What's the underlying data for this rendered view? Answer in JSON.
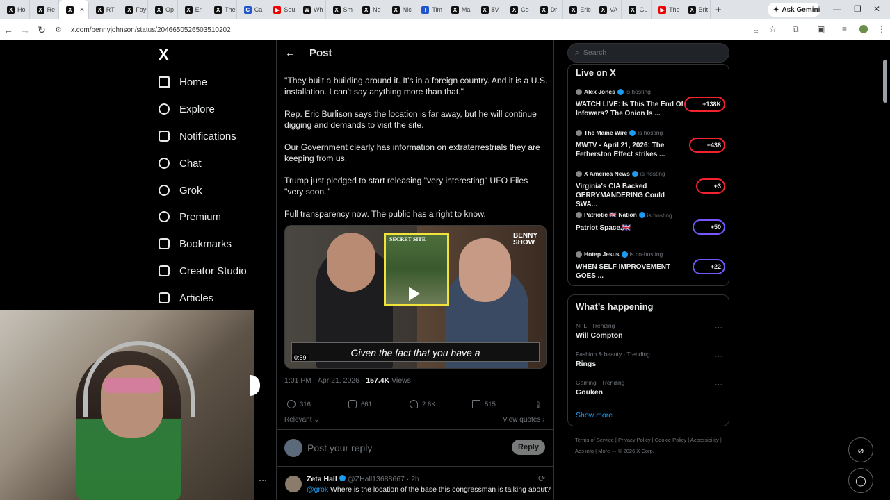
{
  "browser": {
    "tabs": [
      {
        "label": "Ho",
        "fav": "X"
      },
      {
        "label": "Re",
        "fav": "X"
      },
      {
        "label": "",
        "fav": "X",
        "active": true
      },
      {
        "label": "RT",
        "fav": "X"
      },
      {
        "label": "Fay",
        "fav": "X"
      },
      {
        "label": "Op",
        "fav": "X"
      },
      {
        "label": "Eri",
        "fav": "X"
      },
      {
        "label": "The",
        "fav": "X"
      },
      {
        "label": "Ca",
        "fav": "C"
      },
      {
        "label": "Sou",
        "fav": "▶"
      },
      {
        "label": "Wh",
        "fav": "W"
      },
      {
        "label": "Sm",
        "fav": "X"
      },
      {
        "label": "Ne",
        "fav": "X"
      },
      {
        "label": "Nic",
        "fav": "X"
      },
      {
        "label": "Tim",
        "fav": "T"
      },
      {
        "label": "Ma",
        "fav": "X"
      },
      {
        "label": "$V",
        "fav": "X"
      },
      {
        "label": "Co",
        "fav": "X"
      },
      {
        "label": "Dr",
        "fav": "X"
      },
      {
        "label": "Eric",
        "fav": "X"
      },
      {
        "label": "VA",
        "fav": "X"
      },
      {
        "label": "Gu",
        "fav": "X"
      },
      {
        "label": "The",
        "fav": "▶"
      },
      {
        "label": "Brit",
        "fav": "X"
      }
    ],
    "new_tab": "+",
    "ask_gemini": "Ask Gemini",
    "url": "x.com/bennyjohnson/status/2046650526503510202"
  },
  "nav": {
    "logo": "X",
    "items": [
      {
        "label": "Home",
        "name": "home"
      },
      {
        "label": "Explore",
        "name": "explore"
      },
      {
        "label": "Notifications",
        "name": "notifications"
      },
      {
        "label": "Chat",
        "name": "chat"
      },
      {
        "label": "Grok",
        "name": "grok"
      },
      {
        "label": "Premium",
        "name": "premium"
      },
      {
        "label": "Bookmarks",
        "name": "bookmarks"
      },
      {
        "label": "Creator Studio",
        "name": "creator-studio"
      },
      {
        "label": "Articles",
        "name": "articles"
      }
    ]
  },
  "post": {
    "header": "Post",
    "paragraphs": [
      "\"They built a building around it. It's in a foreign country. And it is a U.S. installation. I can't say anything more than that.\"",
      "Rep. Eric Burlison says the location is far away, but he will continue digging and demands to visit the site.",
      "Our Government clearly has information on extraterrestrials they are keeping from us.",
      "Trump just pledged to start releasing \"very interesting\" UFO Files \"very soon.\"",
      "Full transparency now. The public has a right to know."
    ],
    "video": {
      "secret_site": "SECRET SITE",
      "show_label": "BENNY SHOW",
      "caption": "Given the fact that you have a",
      "duration": "0:59"
    },
    "time": "1:01 PM · Apr 21, 2026 · ",
    "views_count": "157.4K",
    "views_label": " Views",
    "replies": "316",
    "reposts": "661",
    "likes": "2.6K",
    "bookmarks": "515",
    "relevant": "Relevant ⌄",
    "view_quotes": "View quotes ›",
    "reply_placeholder": "Post your reply",
    "reply_button": "Reply"
  },
  "reply_tweet": {
    "name": "Zeta Hall",
    "handle": "@ZHall13688667 · 2h",
    "mention": "@grok",
    "text": " Where is the location of the base this congressman is talking about?"
  },
  "right": {
    "search_placeholder": "Search",
    "live_header": "Live on X",
    "live": [
      {
        "host": "Alex Jones",
        "status": "is hosting",
        "title": "WATCH LIVE: Is This The End Of Infowars? The Onion Is ...",
        "count": "+138K"
      },
      {
        "host": "The Maine Wire",
        "status": "is hosting",
        "title": "MWTV - April 21, 2026: The Fetherston Effect strikes ...",
        "count": "+438"
      },
      {
        "host": "X America News",
        "status": "is hosting",
        "title": "Virginia's CIA Backed GERRYMANDERING Could SWA...",
        "count": "+3"
      },
      {
        "host": "Patriotic 🇬🇧 Nation",
        "status": "is hosting",
        "title": "Patriot Space.🇬🇧",
        "count": "+50"
      },
      {
        "host": "Hotep Jesus",
        "status": "is co-hosting",
        "title": "WHEN SELF IMPROVEMENT GOES ...",
        "count": "+22"
      }
    ],
    "happening_header": "What’s happening",
    "trends": [
      {
        "category": "NFL · Trending",
        "name": "Will Compton"
      },
      {
        "category": "Fashion & beauty · Trending",
        "name": "Rings"
      },
      {
        "category": "Gaming · Trending",
        "name": "Gouken"
      }
    ],
    "show_more": "Show more",
    "footer": "Terms of Service  |  Privacy Policy  |  Cookie Policy  |  Accessibility  |  Ads info  |  More ···  © 2026 X Corp."
  },
  "colors": {
    "accent": "#1d9bf0",
    "live_border": "#f4212e",
    "background": "#000000"
  }
}
